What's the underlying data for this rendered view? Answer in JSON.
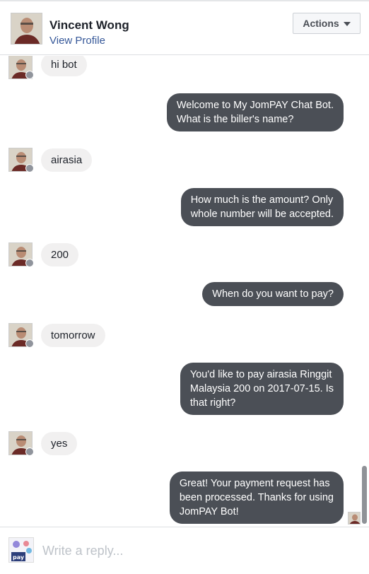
{
  "header": {
    "name": "Vincent Wong",
    "view_profile": "View Profile",
    "actions_label": "Actions"
  },
  "messages": [
    {
      "from": "user",
      "text": "hi bot"
    },
    {
      "from": "bot",
      "text": "Welcome to My JomPAY Chat Bot.\nWhat is the biller's name?"
    },
    {
      "from": "user",
      "text": "airasia"
    },
    {
      "from": "bot",
      "text": "How much is the amount? Only\nwhole number will be accepted."
    },
    {
      "from": "user",
      "text": "200"
    },
    {
      "from": "bot",
      "text": "When do you want to pay?"
    },
    {
      "from": "user",
      "text": "tomorrow"
    },
    {
      "from": "bot",
      "text": "You'd like to pay airasia Ringgit\nMalaysia 200 on 2017-07-15. Is\nthat right?"
    },
    {
      "from": "user",
      "text": "yes"
    },
    {
      "from": "bot",
      "text": "Great!  Your payment request has\nbeen processed.  Thanks for using\nJomPAY Bot!"
    }
  ],
  "composer": {
    "placeholder": "Write a reply...",
    "avatar_text": "pay"
  },
  "colors": {
    "bot_bubble": "#4b4f56",
    "user_bubble": "#f1f0f0",
    "link": "#365899"
  }
}
